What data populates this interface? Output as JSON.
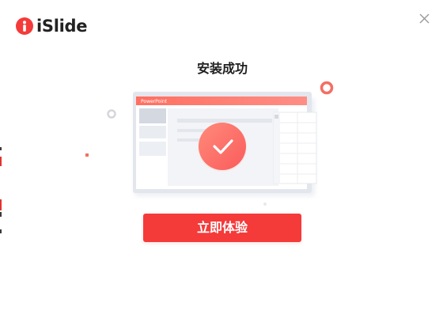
{
  "app": {
    "logo_text": "iSlide",
    "brand_color": "#f53a3a",
    "logo_icon": "islide-logo-icon"
  },
  "window": {
    "close_icon": "close-icon"
  },
  "status": {
    "title": "安装成功"
  },
  "illustration": {
    "app_window_title": "PowerPoint",
    "badge_icon": "checkmark-icon",
    "accent_gradient_start": "#ff6f61",
    "accent_gradient_end": "#ffa69b"
  },
  "actions": {
    "primary_label": "立即体验"
  }
}
